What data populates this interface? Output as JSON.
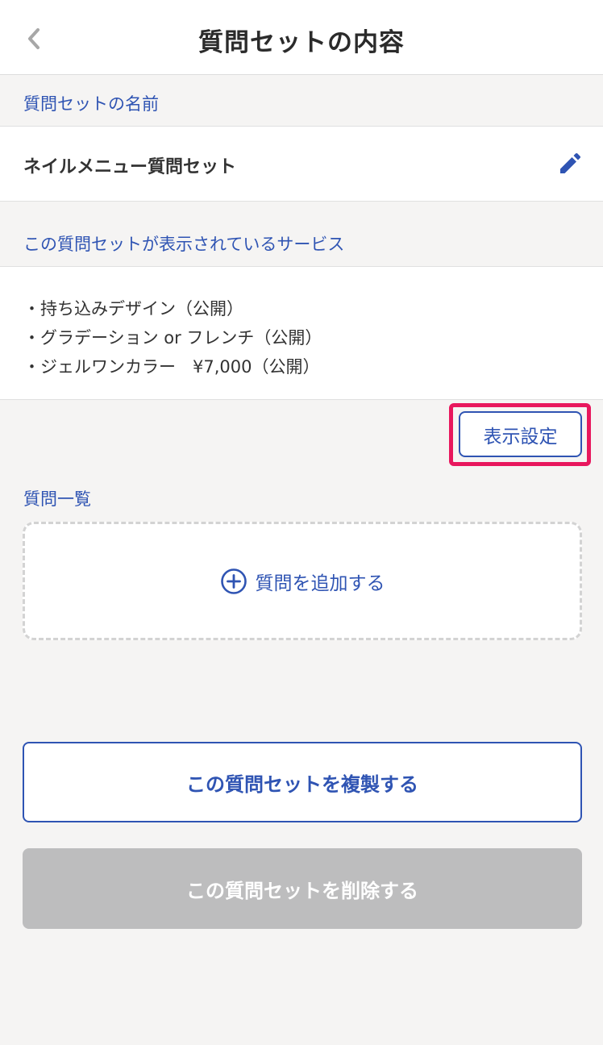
{
  "header": {
    "title": "質問セットの内容",
    "back_icon": "chevron-left-icon"
  },
  "name_section": {
    "label": "質問セットの名前",
    "value": "ネイルメニュー質問セット",
    "edit_icon": "pencil-icon"
  },
  "services_section": {
    "label": "この質問セットが表示されているサービス",
    "items": [
      "・持ち込みデザイン（公開）",
      "・グラデーション or フレンチ（公開）",
      "・ジェルワンカラー　¥7,000（公開）"
    ],
    "display_settings_label": "表示設定"
  },
  "questions_section": {
    "label": "質問一覧",
    "add_label": "質問を追加する",
    "add_icon": "plus-circle-icon"
  },
  "actions": {
    "duplicate_label": "この質問セットを複製する",
    "delete_label": "この質問セットを削除する"
  },
  "colors": {
    "accent": "#2f54b3",
    "highlight": "#e8175d",
    "disabled": "#bdbdbe",
    "background": "#f5f4f3"
  }
}
